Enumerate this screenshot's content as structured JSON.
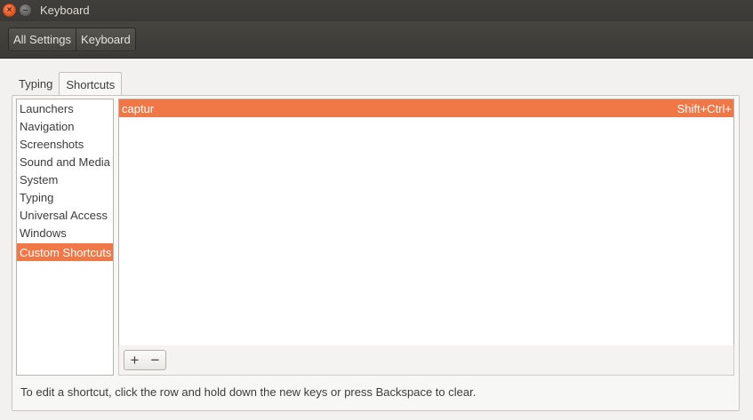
{
  "window": {
    "title": "Keyboard"
  },
  "toolbar": {
    "breadcrumbs": [
      "All Settings",
      "Keyboard"
    ]
  },
  "tabs": [
    {
      "label": "Typing",
      "active": false
    },
    {
      "label": "Shortcuts",
      "active": true
    }
  ],
  "categories": [
    "Launchers",
    "Navigation",
    "Screenshots",
    "Sound and Media",
    "System",
    "Typing",
    "Universal Access",
    "Windows",
    "Custom Shortcuts"
  ],
  "selected_category": "Custom Shortcuts",
  "shortcuts": [
    {
      "name": "captur",
      "accel": "Shift+Ctrl+"
    }
  ],
  "actions": {
    "add": "+",
    "remove": "−"
  },
  "hint": "To edit a shortcut, click the row and hold down the new keys or press Backspace to clear.",
  "colors": {
    "accent": "#f07746",
    "titlebar": "#3c3b37"
  }
}
